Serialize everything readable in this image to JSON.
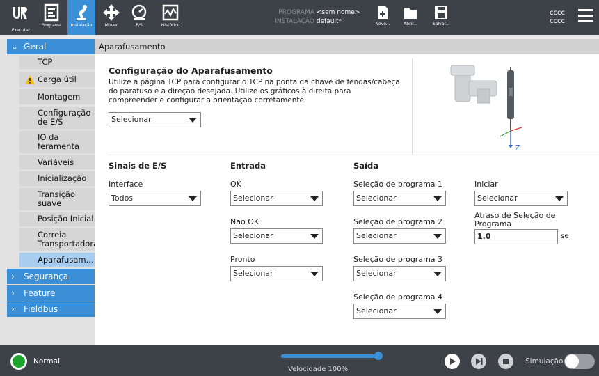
{
  "topbar": {
    "tabs": [
      {
        "label": "Executar"
      },
      {
        "label": "Programa"
      },
      {
        "label": "Instalação"
      },
      {
        "label": "Mover"
      },
      {
        "label": "E/S"
      },
      {
        "label": "Histórico"
      }
    ],
    "program_key": "PROGRAMA",
    "program_value": "<sem nome>",
    "install_key": "INSTALAÇÃO",
    "install_value": "default*",
    "file_buttons": [
      {
        "label": "Novo..."
      },
      {
        "label": "Abrir..."
      },
      {
        "label": "Salvar..."
      }
    ],
    "user_line1": "cccc",
    "user_line2": "cccc"
  },
  "sidebar": {
    "sections": [
      {
        "label": "Geral"
      },
      {
        "label": "Segurança"
      },
      {
        "label": "Feature"
      },
      {
        "label": "Fieldbus"
      }
    ],
    "items": [
      {
        "label": "TCP"
      },
      {
        "label": "Carga útil"
      },
      {
        "label": "Montagem"
      },
      {
        "label": "Configuração de E/S"
      },
      {
        "label": "IO da feramenta"
      },
      {
        "label": "Variáveis"
      },
      {
        "label": "Inicialização"
      },
      {
        "label": "Transição suave"
      },
      {
        "label": "Posição Inicial"
      },
      {
        "label": "Correia Transportadora"
      },
      {
        "label": "Aparafusam..."
      }
    ]
  },
  "main": {
    "breadcrumb": "Aparafusamento",
    "title": "Configuração do Aparafusamento",
    "description": "Utilize a página TCP para configurar o TCP na ponta da chave de fendas/cabeça do parafuso e a direção desejada. Utilize os gráficos à direita para compreender e configurar a orientação corretamente",
    "tcp_select": "Selecionar",
    "axis_label": "Z",
    "io": {
      "signals_header": "Sinais de E/S",
      "input_header": "Entrada",
      "output_header": "Saída",
      "interface_label": "Interface",
      "interface_value": "Todos",
      "ok_label": "OK",
      "ok_value": "Selecionar",
      "notok_label": "Não OK",
      "notok_value": "Selecionar",
      "ready_label": "Pronto",
      "ready_value": "Selecionar",
      "prog1_label": "Seleção de programa 1",
      "prog1_value": "Selecionar",
      "prog2_label": "Seleção de programa 2",
      "prog2_value": "Selecionar",
      "prog3_label": "Seleção de programa 3",
      "prog3_value": "Selecionar",
      "prog4_label": "Seleção de programa 4",
      "prog4_value": "Selecionar",
      "start_label": "Iniciar",
      "start_value": "Selecionar",
      "delay_label": "Atraso de Seleção de Programa",
      "delay_value": "1.0",
      "delay_unit": "se"
    }
  },
  "bottombar": {
    "status": "Normal",
    "speed_label": "Velocidade 100%",
    "speed_fraction": 1.0,
    "simulation_label": "Simulação"
  }
}
